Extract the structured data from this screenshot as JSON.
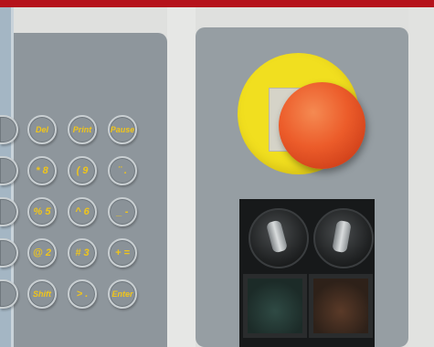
{
  "keypad": {
    "keys": [
      {
        "label": "Del"
      },
      {
        "label": "Print"
      },
      {
        "label": "Pause"
      },
      {
        "label": "* 8"
      },
      {
        "label": "( 9"
      },
      {
        "label": "¨ ."
      },
      {
        "label": "% 5"
      },
      {
        "label": "^ 6"
      },
      {
        "label": "_ -"
      },
      {
        "label": "@ 2"
      },
      {
        "label": "# 3"
      },
      {
        "label": "+ ="
      },
      {
        "label": "Shift"
      },
      {
        "label": "> ."
      },
      {
        "label": "Enter"
      }
    ]
  },
  "colors": {
    "accent": "#b5121b",
    "key_text": "#f0c51a",
    "estop": "#ec5c2a",
    "estop_base": "#f1df1f"
  }
}
